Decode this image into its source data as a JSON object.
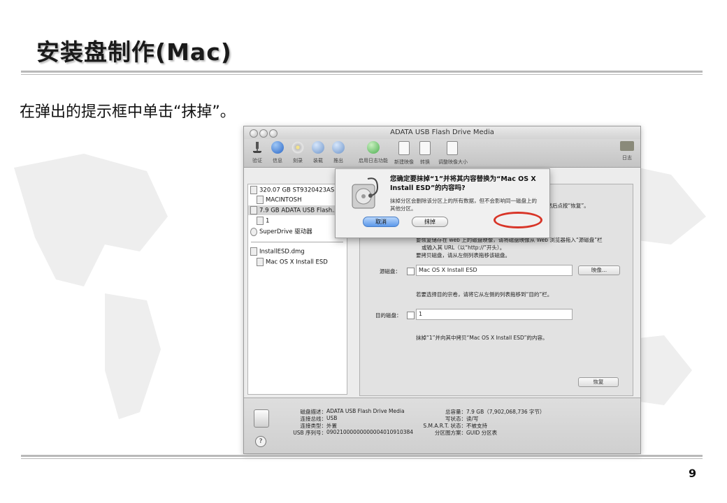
{
  "slide": {
    "title": "安装盘制作(Mac)",
    "instruction": "在弹出的提示框中单击“抹掉”。",
    "page_number": "9"
  },
  "window": {
    "title": "ADATA USB Flash Drive Media",
    "toolbar": [
      {
        "label": "验证",
        "icon": "microscope-icon"
      },
      {
        "label": "信息",
        "icon": "info-icon"
      },
      {
        "label": "刻录",
        "icon": "burn-icon"
      },
      {
        "label": "装载",
        "icon": "mount-icon"
      },
      {
        "label": "推出",
        "icon": "eject-icon"
      },
      {
        "label": "启用日志功能",
        "icon": "journal-icon"
      },
      {
        "label": "新建映像",
        "icon": "new-image-icon"
      },
      {
        "label": "转换",
        "icon": "convert-icon"
      },
      {
        "label": "调整映像大小",
        "icon": "resize-image-icon"
      },
      {
        "label": "日志",
        "icon": "log-icon"
      }
    ],
    "sidebar": [
      {
        "label": "320.07 GB ST9320423AS",
        "icon": "drive-icon"
      },
      {
        "label": "MACINTOSH",
        "icon": "volume-icon"
      },
      {
        "label": "7.9 GB ADATA USB Flash...",
        "icon": "usb-drive-icon"
      },
      {
        "label": "1",
        "icon": "volume-icon"
      },
      {
        "label": "SuperDrive 驱动器",
        "icon": "superdrive-icon"
      },
      {
        "label": "InstallESD.dmg",
        "icon": "dmg-icon"
      },
      {
        "label": "Mac OS X Install ESD",
        "icon": "volume-icon"
      }
    ],
    "restore": {
      "partial_top": "宗卷，然后点按“恢复”。",
      "bullet1": "要恢复储存在 web 上的磁盘映像，请将磁盘映像从 Web 浏览器拖入“源磁盘”栏",
      "bullet1b": "或输入其 URL（以“http://”开头）。",
      "bullet2": "要拷贝磁盘，请从左侧列表拖移该磁盘。",
      "source_label": "源磁盘：",
      "source_value": "Mac OS X Install ESD",
      "image_button": "映像...",
      "dest_hint": "若要选择目的宗卷，请将它从左侧的列表拖移到“目的”栏。",
      "dest_label": "目的磁盘：",
      "dest_value": "1",
      "summary": "抹掉“1”并向其中拷贝“Mac OS X Install ESD”的内容。",
      "restore_button": "恢复"
    },
    "info": {
      "desc_label": "磁盘描述：",
      "desc_value": "ADATA USB Flash Drive Media",
      "bus_label": "连接总线：",
      "bus_value": "USB",
      "type_label": "连接类型：",
      "type_value": "外置",
      "serial_label": "USB 序列号：",
      "serial_value": "09021000000000004010910384",
      "capacity_label": "总容量：",
      "capacity_value": "7.9 GB（7,902,068,736 字节）",
      "write_label": "写状态：",
      "write_value": "读/写",
      "smart_label": "S.M.A.R.T. 状态：",
      "smart_value": "不被支持",
      "partition_label": "分区图方案：",
      "partition_value": "GUID 分区表"
    },
    "dialog": {
      "title": "您确定要抹掉“1”并将其内容替换为“Mac OS X Install ESD”的内容吗?",
      "body": "抹掉分区会删除该分区上的所有数据，但不会影响同一磁盘上的其他分区。",
      "cancel_label": "取消",
      "erase_label": "抹掉"
    }
  },
  "colors": {
    "highlight": "#d83528",
    "default_button": "#5b98ea"
  }
}
